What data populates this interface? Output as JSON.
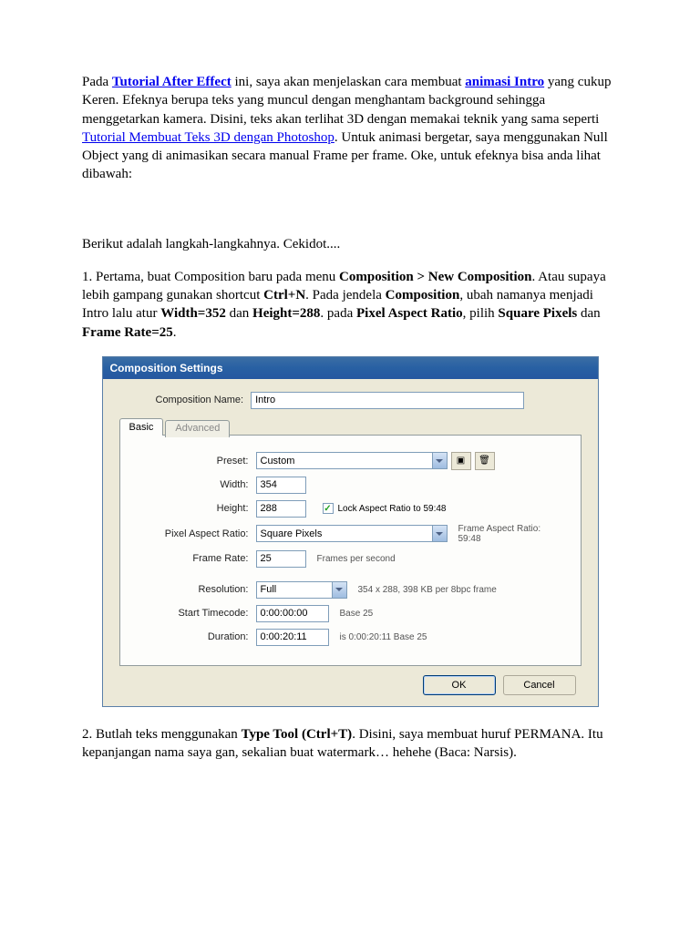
{
  "intro": {
    "pre1": "Pada ",
    "link1": "Tutorial After Effect",
    "mid1": " ini, saya akan menjelaskan cara membuat ",
    "link2": "animasi Intro",
    "post1": " yang cukup Keren. Efeknya berupa teks yang muncul dengan menghantam background sehingga menggetarkan kamera. Disini, teks akan terlihat 3D dengan memakai teknik yang sama seperti ",
    "link3": "Tutorial Membuat Teks 3D dengan Photoshop",
    "post2": ". Untuk animasi bergetar, saya menggunakan Null Object yang di animasikan secara manual Frame per frame. Oke, untuk efeknya bisa anda lihat dibawah:"
  },
  "steps_intro": "Berikut adalah langkah-langkahnya. Cekidot....",
  "step1": {
    "pre": "1. Pertama, buat Composition baru pada menu ",
    "b1": "Composition > New Composition",
    "t1": ". Atau supaya lebih gampang gunakan shortcut ",
    "b2": "Ctrl+N",
    "t2": ". Pada jendela ",
    "b3": "Composition",
    "t3": ", ubah namanya menjadi Intro lalu atur ",
    "b4": "Width=352",
    "t4": " dan ",
    "b5": "Height=288",
    "t5": ". pada ",
    "b6": "Pixel Aspect Ratio",
    "t6": ", pilih ",
    "b7": "Square Pixels",
    "t7": " dan ",
    "b8": "Frame Rate=25",
    "t8": "."
  },
  "dialog": {
    "title": "Composition Settings",
    "compNameLabel": "Composition Name:",
    "compNameValue": "Intro",
    "tabBasic": "Basic",
    "tabAdvanced": "Advanced",
    "presetLabel": "Preset:",
    "presetValue": "Custom",
    "widthLabel": "Width:",
    "widthValue": "354",
    "heightLabel": "Height:",
    "heightValue": "288",
    "lockLabel": "Lock Aspect Ratio to 59:48",
    "parLabel": "Pixel Aspect Ratio:",
    "parValue": "Square Pixels",
    "farLabel": "Frame Aspect Ratio:\n59:48",
    "frLabel": "Frame Rate:",
    "frValue": "25",
    "fpsLabel": "Frames per second",
    "resLabel": "Resolution:",
    "resValue": "Full",
    "resNote": "354 x 288, 398 KB per 8bpc frame",
    "startLabel": "Start Timecode:",
    "startValue": "0:00:00:00",
    "startNote": "Base 25",
    "durLabel": "Duration:",
    "durValue": "0:00:20:11",
    "durNote": "is 0:00:20:11 Base 25",
    "ok": "OK",
    "cancel": "Cancel"
  },
  "step2": {
    "pre": "2. Butlah teks menggunakan ",
    "b1": "Type Tool (Ctrl+T)",
    "post": ". Disini, saya membuat huruf PERMANA. Itu kepanjangan nama saya gan, sekalian buat watermark… hehehe (Baca: Narsis)."
  }
}
